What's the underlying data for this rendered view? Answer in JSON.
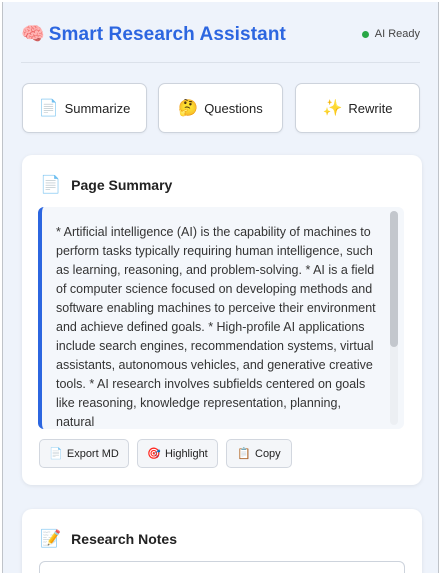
{
  "header": {
    "title_icon": "🧠",
    "title": "Smart Research Assistant",
    "status_text": "AI Ready",
    "status_color": "#28a745"
  },
  "actions": [
    {
      "icon": "📄",
      "label": "Summarize"
    },
    {
      "icon": "🤔",
      "label": "Questions"
    },
    {
      "icon": "✨",
      "label": "Rewrite"
    }
  ],
  "summary": {
    "icon": "📄",
    "title": "Page Summary",
    "text": "* Artificial intelligence (AI) is the capability of machines to perform tasks typically requiring human intelligence, such as learning, reasoning, and problem-solving. * AI is a field of computer science focused on developing methods and software enabling machines to perceive their environment and achieve defined goals. * High-profile AI applications include search engines, recommendation systems, virtual assistants, autonomous vehicles, and generative creative tools. * AI research involves subfields centered on goals like reasoning, knowledge representation, planning, natural",
    "tools": [
      {
        "icon": "📄",
        "label": "Export MD"
      },
      {
        "icon": "🎯",
        "label": "Highlight"
      },
      {
        "icon": "📋",
        "label": "Copy"
      }
    ]
  },
  "notes": {
    "icon": "📝",
    "title": "Research Notes"
  },
  "colors": {
    "accent": "#2c66e0",
    "background": "#eef3fb"
  }
}
